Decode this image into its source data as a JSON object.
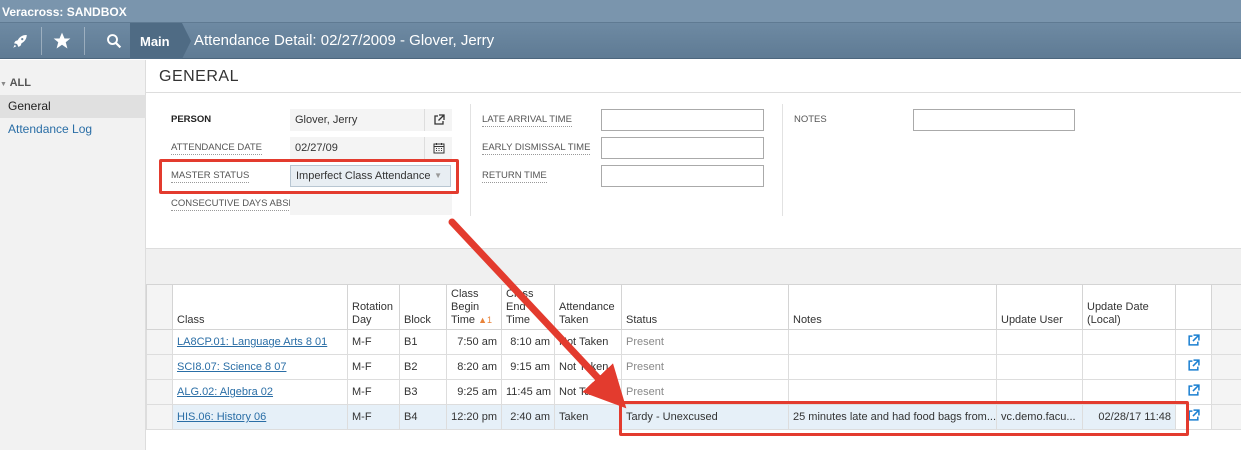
{
  "app": {
    "title": "Veracross: SANDBOX"
  },
  "nav": {
    "main_label": "Main",
    "page_title": "Attendance Detail: 02/27/2009 - Glover, Jerry",
    "icons": [
      "rocket-icon",
      "star-icon",
      "search-icon"
    ]
  },
  "sidebar": {
    "all_label": "ALL",
    "items": [
      {
        "label": "General",
        "active": true
      },
      {
        "label": "Attendance Log",
        "active": false
      }
    ]
  },
  "section": {
    "title": "GENERAL"
  },
  "form": {
    "person_label": "PERSON",
    "person_value": "Glover, Jerry",
    "date_label": "ATTENDANCE DATE",
    "date_value": "02/27/09",
    "master_status_label": "MASTER STATUS",
    "master_status_value": "Imperfect Class Attendance",
    "consecutive_label": "CONSECUTIVE DAYS ABSE...",
    "late_arrival_label": "LATE ARRIVAL TIME",
    "early_dismissal_label": "EARLY DISMISSAL TIME",
    "return_time_label": "RETURN TIME",
    "notes_label": "NOTES"
  },
  "table": {
    "headers": {
      "class": "Class",
      "rotation_day": "Rotation Day",
      "block": "Block",
      "begin_time": "Class Begin Time",
      "sort_indicator": "1",
      "end_time": "Class End Time",
      "attendance_taken": "Attendance Taken",
      "status": "Status",
      "notes": "Notes",
      "update_user": "Update User",
      "update_date": "Update Date (Local)"
    },
    "rows": [
      {
        "class": "LA8CP.01: Language Arts 8 01",
        "rotation_day": "M-F",
        "block": "B1",
        "begin": "7:50 am",
        "end": "8:10 am",
        "taken": "Not Taken",
        "status": "Present",
        "notes": "",
        "user": "",
        "date": ""
      },
      {
        "class": "SCI8.07: Science 8 07",
        "rotation_day": "M-F",
        "block": "B2",
        "begin": "8:20 am",
        "end": "9:15 am",
        "taken": "Not Taken",
        "status": "Present",
        "notes": "",
        "user": "",
        "date": ""
      },
      {
        "class": "ALG.02: Algebra 02",
        "rotation_day": "M-F",
        "block": "B3",
        "begin": "9:25 am",
        "end": "11:45 am",
        "taken": "Not Taken",
        "status": "Present",
        "notes": "",
        "user": "",
        "date": ""
      },
      {
        "class": "HIS.06: History 06",
        "rotation_day": "M-F",
        "block": "B4",
        "begin": "12:20 pm",
        "end": "2:40 am",
        "taken": "Taken",
        "status": "Tardy - Unexcused",
        "notes": "25 minutes late and had food bags from...",
        "user": "vc.demo.facu...",
        "date": "02/28/17 11:48"
      }
    ]
  },
  "colors": {
    "accent": "#2a6ea6",
    "highlight": "#e33b2e",
    "nav": "#6e8aa3"
  }
}
